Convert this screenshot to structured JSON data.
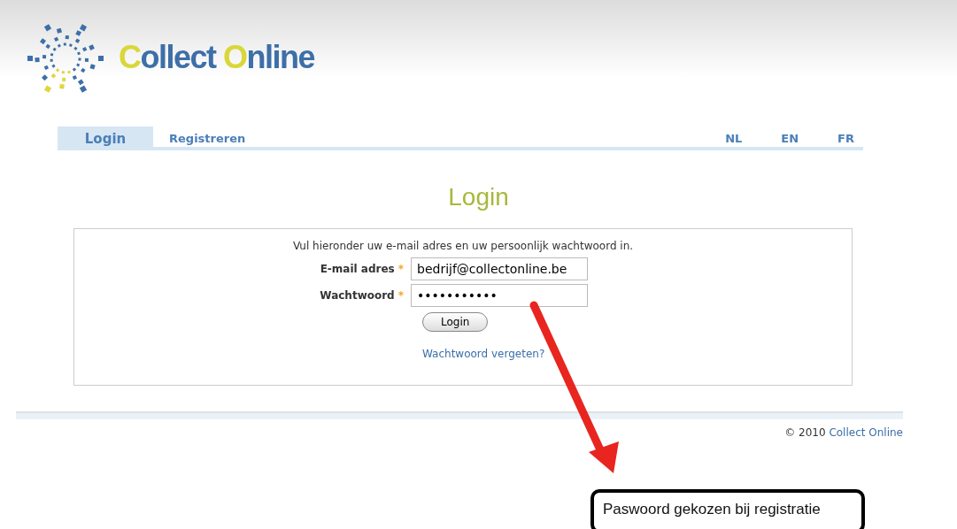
{
  "header": {
    "logo_text": [
      {
        "text": "C",
        "highlight": true
      },
      {
        "text": "ollect ",
        "highlight": false
      },
      {
        "text": "O",
        "highlight": true
      },
      {
        "text": "nline",
        "highlight": false
      }
    ]
  },
  "tabs": [
    {
      "label": "Login",
      "selected": true
    },
    {
      "label": "Registreren",
      "selected": false
    }
  ],
  "languages": [
    "NL",
    "EN",
    "FR"
  ],
  "title": "Login",
  "form": {
    "intro": "Vul hieronder uw e-mail adres en uw persoonlijk wachtwoord in.",
    "fields": [
      {
        "label": "E-mail adres",
        "required_mark": "*",
        "value": "bedrijf@collectonline.be"
      },
      {
        "label": "Wachtwoord",
        "required_mark": "*",
        "value": "•••••••••••"
      }
    ],
    "button": "Login",
    "forgot_link": "Wachtwoord vergeten?"
  },
  "footer": {
    "copyright": "© 2010",
    "link": "Collect Online"
  },
  "annotation": {
    "text": "Paswoord gekozen bij registratie"
  }
}
